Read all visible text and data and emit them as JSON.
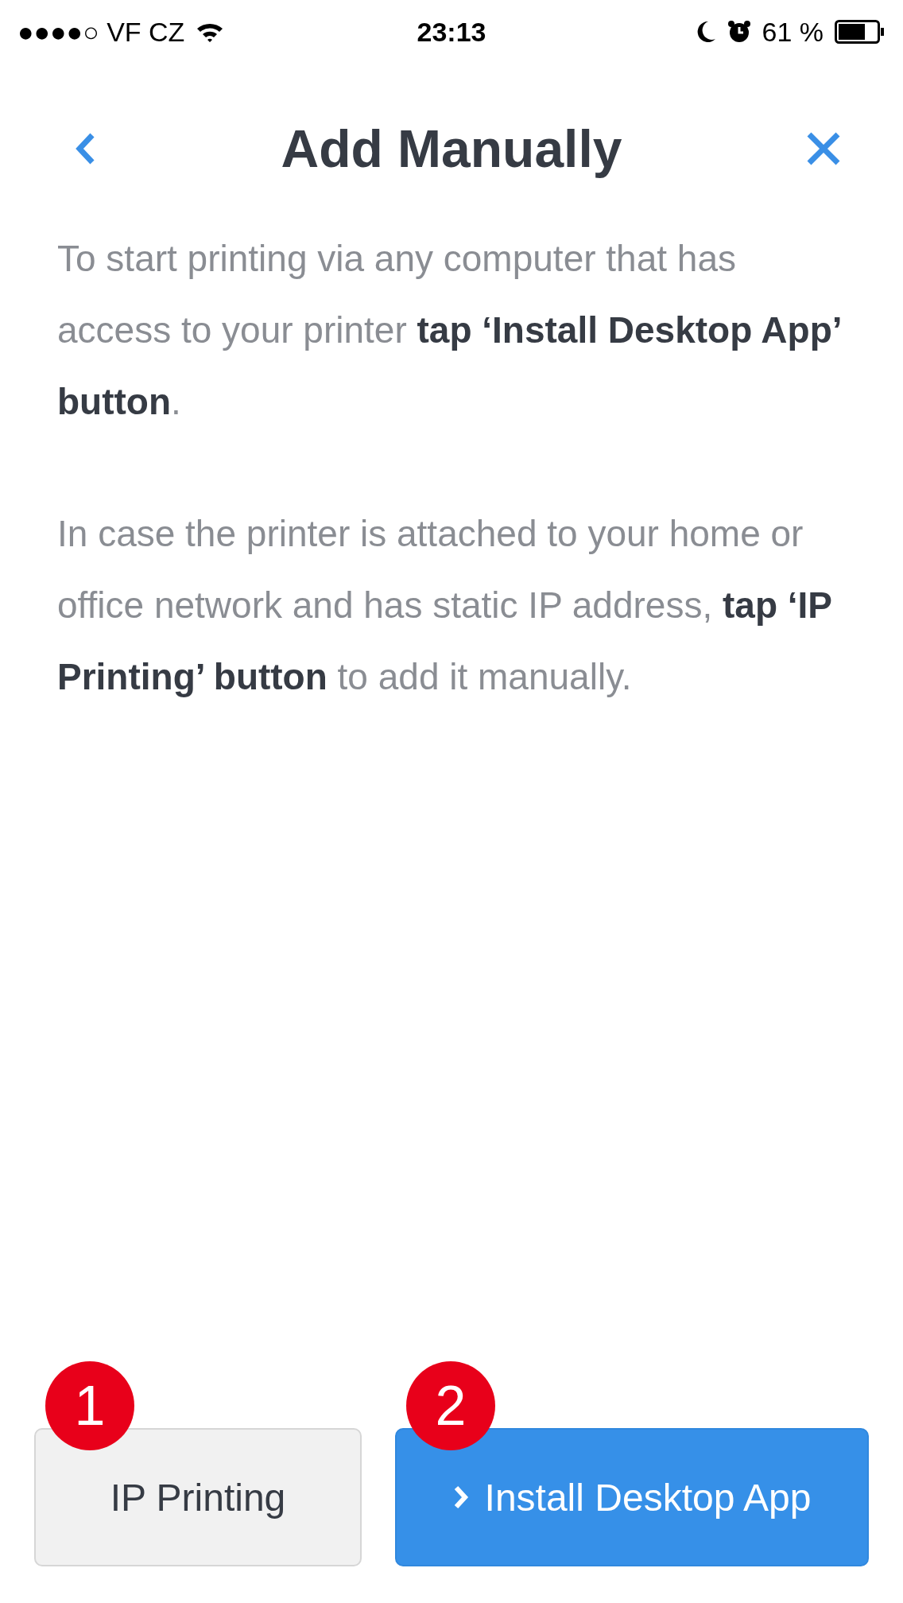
{
  "status_bar": {
    "carrier": "●●●●○ VF CZ",
    "time": "23:13",
    "battery": "61 %"
  },
  "nav": {
    "title": "Add Manually"
  },
  "paragraphs": [
    "To start printing via any computer that has access to your printer **tap ‘Install Desktop App’ button**.",
    "In case the printer is attached to your home or office network and has static IP address, **tap ‘IP Printing’ button** to add it manually."
  ],
  "buttons": [
    {
      "kind": "secondary",
      "label": "IP Printing",
      "badge": "1"
    },
    {
      "kind": "primary",
      "label": "Install Desktop App",
      "badge": "2"
    }
  ]
}
